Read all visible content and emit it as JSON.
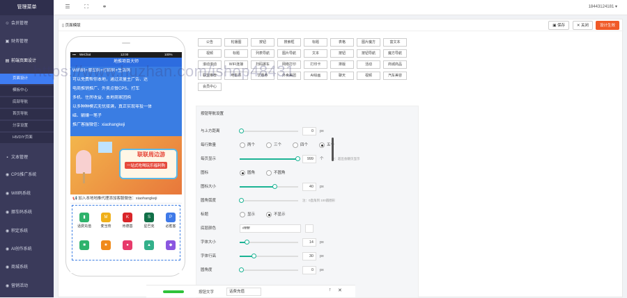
{
  "sidebar": {
    "brand": "管理菜单",
    "items": [
      {
        "label": "会员管理",
        "icon": "user-icon"
      },
      {
        "label": "财务管理",
        "icon": "wallet-icon"
      },
      {
        "label": "前端页面设计",
        "icon": "page-icon"
      },
      {
        "label": "CPS推广系统",
        "icon": "cps-icon"
      },
      {
        "label": "Wifi码系统",
        "icon": "wifi-icon"
      },
      {
        "label": "挪车码系统",
        "icon": "car-icon"
      },
      {
        "label": "积定系统",
        "icon": "gear-icon"
      },
      {
        "label": "AI创作系统",
        "icon": "ai-icon"
      },
      {
        "label": "商城系统",
        "icon": "shop-icon"
      },
      {
        "label": "营销活动",
        "icon": "gift-icon"
      }
    ],
    "subitems": [
      "页面设计",
      "模板中心",
      "底部导航",
      "首页导航",
      "分享设置",
      "H5/DIY页面"
    ],
    "extra_item": "文本管理"
  },
  "topbar": {
    "user": "18443124181"
  },
  "toolbar": {
    "tab": "页面模版",
    "save": "保存",
    "close": "关闭",
    "apply": "设计生效"
  },
  "phone": {
    "carrier": "WeChat",
    "time": "12:00",
    "battery": "100%",
    "title": "地推项目大师",
    "notice_lines": [
      "WIFI码+挪车码+打印码+生活码",
      "可以免费帮你本地，通过流量主广告、达",
      "电商推销推广、外卖点餐CPS、打车",
      "多机、住房收益、本地商家团购",
      "以多种种模式无忧接满，真正实现零投一体",
      "磁、躺赚一笔子"
    ],
    "contact": "推广客服微信：xiaohangkeji",
    "banner_title": "联联周边游",
    "banner_sub": "一站式吃喝玩乐福利购",
    "marquee": "📢 加入本地地推代理添加客服微信：xiaohangkeji",
    "grid": [
      {
        "label": "话费充值",
        "color": "#2fb36c",
        "glyph": "▮"
      },
      {
        "label": "麦当劳",
        "color": "#f0b01a",
        "glyph": "M"
      },
      {
        "label": "肯德基",
        "color": "#d9262a",
        "glyph": "K"
      },
      {
        "label": "星巴克",
        "color": "#117048",
        "glyph": "S"
      },
      {
        "label": "必胜客",
        "color": "#3f7ae8",
        "glyph": "P"
      },
      {
        "label": "",
        "color": "#2fb36c",
        "glyph": "■"
      },
      {
        "label": "",
        "color": "#f08a1a",
        "glyph": "★"
      },
      {
        "label": "",
        "color": "#e73b6b",
        "glyph": "●"
      },
      {
        "label": "",
        "color": "#33b08a",
        "glyph": "▲"
      },
      {
        "label": "",
        "color": "#8a56e0",
        "glyph": "◆"
      }
    ]
  },
  "components": [
    "公告",
    "轮播图",
    "按钮",
    "搜索框",
    "标题",
    "表格",
    "图片魔方",
    "富文本",
    "视频",
    "标题",
    "列表导航",
    "图片导航",
    "文本",
    "按钮",
    "按钮导航",
    "魔方导航",
    "滚动滚动",
    "WIFI连接",
    "扫码挪车",
    "网络打印",
    "打印卡",
    "排版",
    "活动",
    "商城商品",
    "联盟推荐",
    "电影票",
    "优惠券",
    "外卖美团",
    "AI绘画",
    "聊天",
    "视频",
    "汽车美容",
    "会员中心"
  ],
  "settings": {
    "header": "按钮导航设置",
    "rows": [
      {
        "label": "与上方距离",
        "value": "0",
        "unit": "px"
      },
      {
        "label": "每行数量",
        "options": [
          "两个",
          "三个",
          "四个",
          "五个"
        ],
        "selected": 3
      },
      {
        "label": "每页显示",
        "value": "999",
        "unit": "个",
        "hint": "注：超出会翻页显示"
      },
      {
        "label": "图标",
        "options": [
          "圆角",
          "不圆角"
        ],
        "selected": 0
      },
      {
        "label": "图标大小",
        "value": "40",
        "unit": "px"
      },
      {
        "label": "圆角弧度",
        "hint": "注：0直角到 100圆圈形"
      },
      {
        "label": "标题",
        "options": [
          "显示",
          "不显示"
        ],
        "selected": 1
      },
      {
        "label": "底层颜色",
        "color_value": "#ffffff"
      },
      {
        "label": "字体大小",
        "value": "14",
        "unit": "px"
      },
      {
        "label": "字体行高",
        "value": "30",
        "unit": "px"
      },
      {
        "label": "圆角度",
        "value": "0",
        "unit": "px"
      }
    ]
  },
  "floatbar": {
    "label1": "按钮文字",
    "label2": "话费充值"
  },
  "watermark": "https://www.huzhan.com/ishop48431"
}
